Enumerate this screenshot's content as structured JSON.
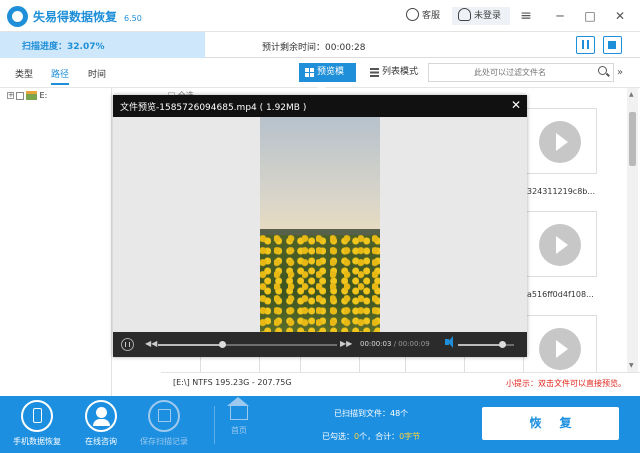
{
  "app": {
    "title": "失易得数据恢复",
    "version": "6.50"
  },
  "titlebar": {
    "service_label": "客服",
    "login_label": "未登录",
    "menu_icon": "hamburger-icon",
    "minimize": "─",
    "maximize": "□",
    "close": "✕"
  },
  "scan": {
    "progress_label": "扫描进度：32.07%",
    "progress_fraction": 0.3207,
    "remaining_label": "预计剩余时间：00:00:28"
  },
  "tabs": {
    "type": "类型",
    "path": "路径",
    "time": "时间",
    "active": "路径"
  },
  "view_modes": {
    "preview": "预览模式",
    "list": "列表模式",
    "active": "预览模式"
  },
  "filter": {
    "placeholder": "此处可以过滤文件名"
  },
  "tree": {
    "root_label": "E:"
  },
  "grid": {
    "select_all": "全选",
    "file_names": [
      "324311219c8b...",
      "a516ff0d4f108..."
    ]
  },
  "preview": {
    "title": "文件预览-1585726094685.mp4 ( 1.92MB )",
    "current_time": "00:00:03",
    "duration": "/ 00:00:09",
    "seek_fraction": 0.36,
    "volume_fraction": 0.78
  },
  "status": {
    "disk_info": "[E:\\]  NTFS 195.23G - 207.75G",
    "tip": "小提示：双击文件可以直接预览。"
  },
  "bottom": {
    "phone_recover": "手机数据恢复",
    "online_consult": "在线咨询",
    "save_record": "保存扫描记录",
    "home": "首页",
    "scanned_files": "已扫描到文件：48个",
    "picked_prefix": "已勾选：",
    "picked_count": "0",
    "picked_mid": "个，合计：",
    "picked_size": "0字节",
    "recover_label": "恢复"
  },
  "colors": {
    "accent": "#1e8fd8",
    "bottom_bar": "#1c8fe0",
    "tip_red": "#e0241b"
  }
}
